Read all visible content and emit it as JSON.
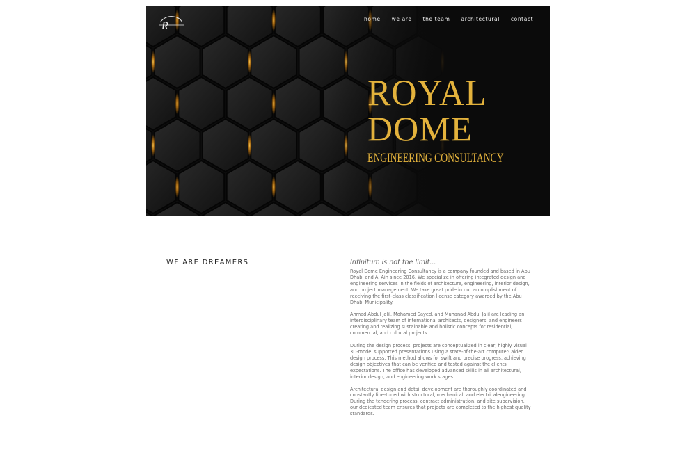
{
  "nav": {
    "items": [
      "home",
      "we are",
      "the team",
      "architectural",
      "contact"
    ]
  },
  "hero": {
    "brand_line1": "ROYAL",
    "brand_line2": "DOME",
    "brand_line3": "ENGINEERING CONSULTANCY",
    "accent_color": "#e3b23c",
    "background": "#0b0b0b",
    "logo_icon": "rd-logo-icon"
  },
  "about": {
    "heading": "WE ARE DREAMERS",
    "tagline": "Infinitum is not the limit...",
    "paragraphs": [
      "Royal Dome Engineering Consultancy is a company founded and based in Abu Dhabi and Al Ain since 2016. We specialize in offering integrated design and engineering services in the fields of architecture, engineering, interior design, and project management. We take great pride in our accomplishment of receiving the first-class classification license category awarded by the Abu Dhabi Municipality.",
      "Ahmad Abdul Jalil, Mohamed Sayed, and Muhanad Abdul Jalil are leading an interdisciplinary team of international architects, designers, and engineers creating and realizing sustainable and holistic concepts for residential, commercial, and cultural projects.",
      "During the design process, projects are conceptualized in clear, highly visual 3D-model supported presentations using a state-of-the-art computer- aided design process. This method allows for swift and precise progress, achieving design objectives that can be verified and tested against the clients' expectations. The office has developed advanced skills in all architectural, interior design, and engineering work stages.",
      "Architectural design and detail development are thoroughly coordinated and constantly fine-tuned with structural, mechanical, and electricalengineering. During the tendering process, contract administration, and site supervision, our dedicated team ensures that projects are completed to the highest quality standards."
    ]
  }
}
